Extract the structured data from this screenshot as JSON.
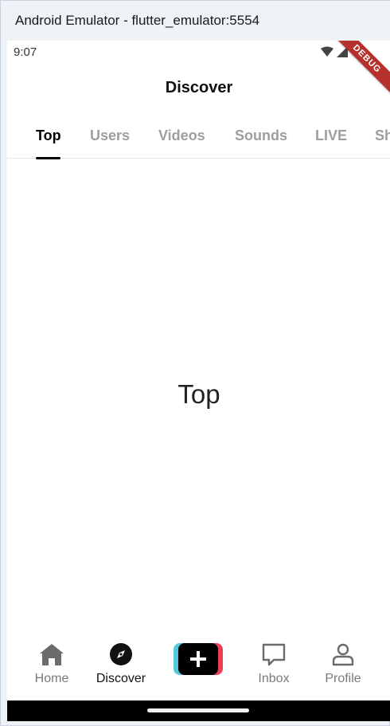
{
  "window": {
    "title": "Android Emulator - flutter_emulator:5554"
  },
  "status": {
    "time": "9:07",
    "wifi_icon": "wifi-icon",
    "signal_icon": "signal-icon"
  },
  "debug_banner": "DEBUG",
  "appbar": {
    "title": "Discover"
  },
  "tabs": [
    {
      "label": "Top",
      "active": true
    },
    {
      "label": "Users"
    },
    {
      "label": "Videos"
    },
    {
      "label": "Sounds"
    },
    {
      "label": "LIVE"
    },
    {
      "label": "Sh"
    }
  ],
  "content": {
    "text": "Top"
  },
  "bottom_nav": {
    "items": [
      {
        "label": "Home",
        "icon": "home-icon"
      },
      {
        "label": "Discover",
        "icon": "compass-icon",
        "active": true
      },
      {
        "label": "",
        "icon": "plus-icon"
      },
      {
        "label": "Inbox",
        "icon": "chat-icon"
      },
      {
        "label": "Profile",
        "icon": "person-icon"
      }
    ]
  },
  "colors": {
    "create_left": "#56c8dd",
    "create_right": "#ea4058",
    "debug": "#b7312c"
  }
}
